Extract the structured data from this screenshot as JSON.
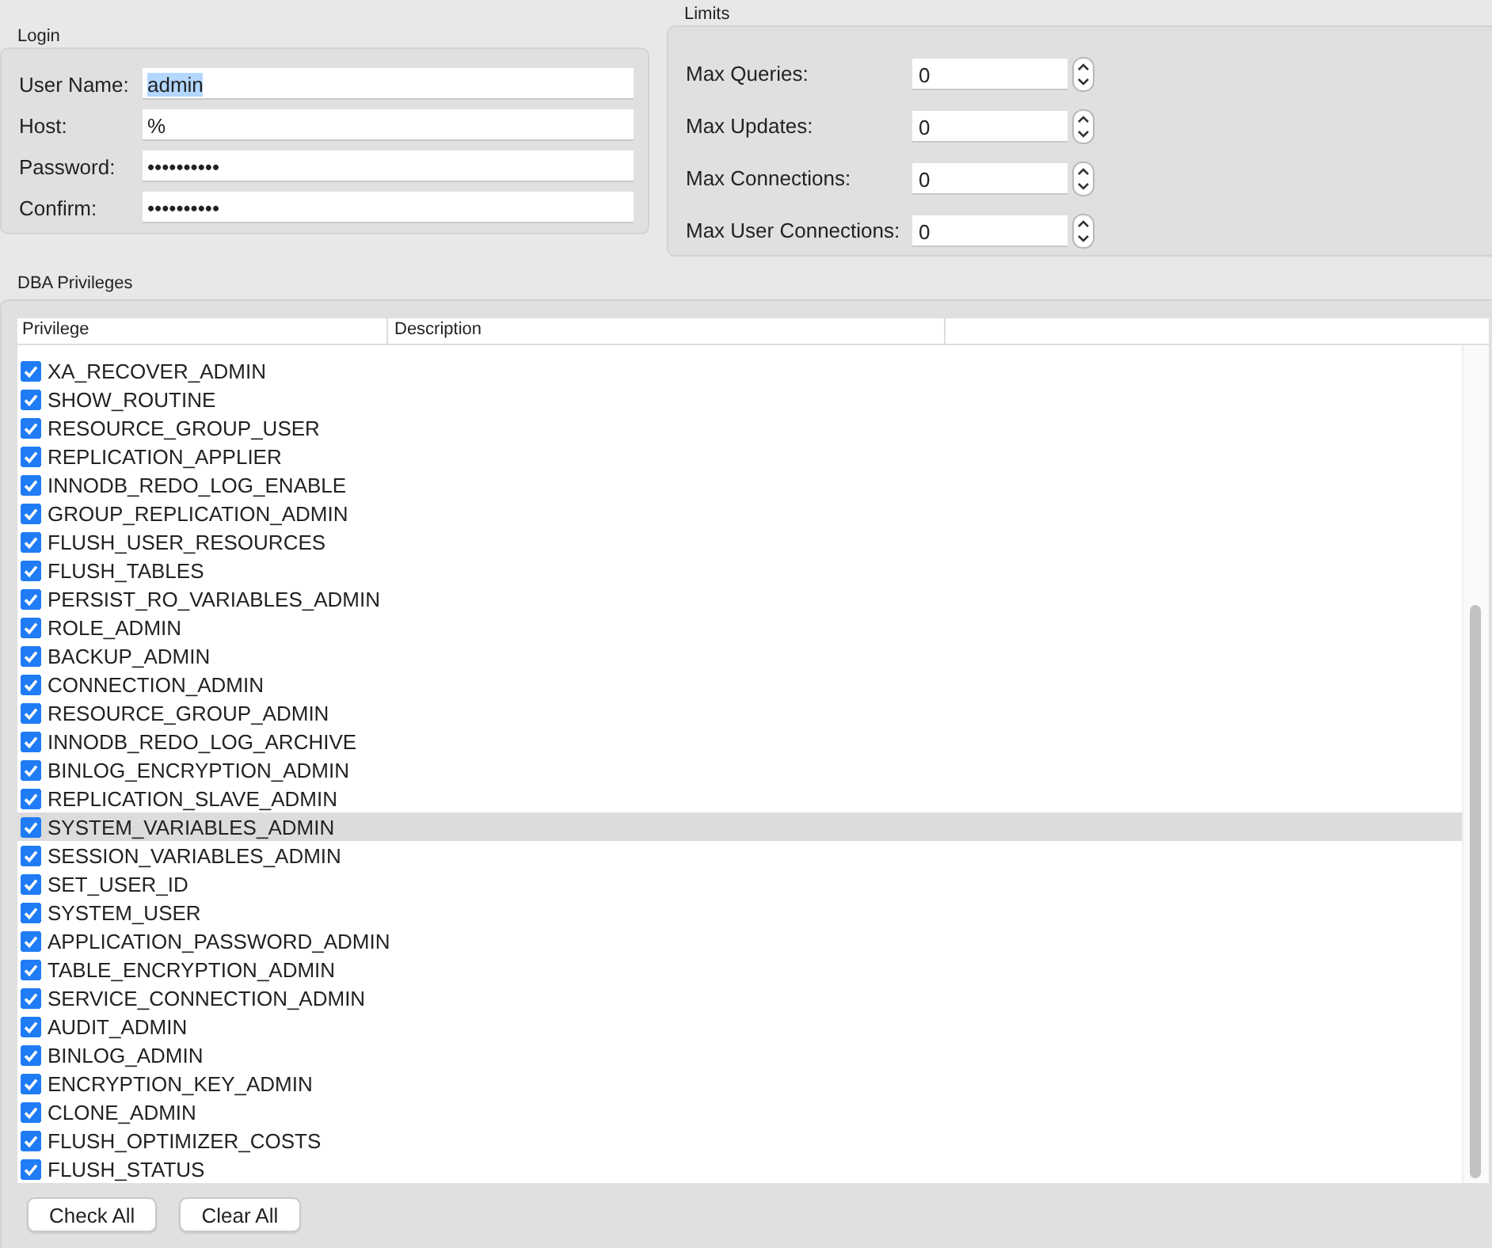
{
  "login": {
    "title": "Login",
    "fields": [
      {
        "label": "User Name:",
        "value": "admin",
        "text_selected": true
      },
      {
        "label": "Host:",
        "value": "%",
        "text_selected": false
      },
      {
        "label": "Password:",
        "value": "••••••••••",
        "text_selected": false
      },
      {
        "label": "Confirm:",
        "value": "••••••••••",
        "text_selected": false
      }
    ]
  },
  "limits": {
    "title": "Limits",
    "fields": [
      {
        "label": "Max Queries:",
        "value": "0"
      },
      {
        "label": "Max Updates:",
        "value": "0"
      },
      {
        "label": "Max Connections:",
        "value": "0"
      },
      {
        "label": "Max User Connections:",
        "value": "0"
      }
    ]
  },
  "privileges": {
    "title": "DBA Privileges",
    "columns": [
      "Privilege",
      "Description"
    ],
    "rows": [
      {
        "name": "XA_RECOVER_ADMIN",
        "checked": true,
        "selected": false
      },
      {
        "name": "SHOW_ROUTINE",
        "checked": true,
        "selected": false
      },
      {
        "name": "RESOURCE_GROUP_USER",
        "checked": true,
        "selected": false
      },
      {
        "name": "REPLICATION_APPLIER",
        "checked": true,
        "selected": false
      },
      {
        "name": "INNODB_REDO_LOG_ENABLE",
        "checked": true,
        "selected": false
      },
      {
        "name": "GROUP_REPLICATION_ADMIN",
        "checked": true,
        "selected": false
      },
      {
        "name": "FLUSH_USER_RESOURCES",
        "checked": true,
        "selected": false
      },
      {
        "name": "FLUSH_TABLES",
        "checked": true,
        "selected": false
      },
      {
        "name": "PERSIST_RO_VARIABLES_ADMIN",
        "checked": true,
        "selected": false
      },
      {
        "name": "ROLE_ADMIN",
        "checked": true,
        "selected": false
      },
      {
        "name": "BACKUP_ADMIN",
        "checked": true,
        "selected": false
      },
      {
        "name": "CONNECTION_ADMIN",
        "checked": true,
        "selected": false
      },
      {
        "name": "RESOURCE_GROUP_ADMIN",
        "checked": true,
        "selected": false
      },
      {
        "name": "INNODB_REDO_LOG_ARCHIVE",
        "checked": true,
        "selected": false
      },
      {
        "name": "BINLOG_ENCRYPTION_ADMIN",
        "checked": true,
        "selected": false
      },
      {
        "name": "REPLICATION_SLAVE_ADMIN",
        "checked": true,
        "selected": false
      },
      {
        "name": "SYSTEM_VARIABLES_ADMIN",
        "checked": true,
        "selected": true
      },
      {
        "name": "SESSION_VARIABLES_ADMIN",
        "checked": true,
        "selected": false
      },
      {
        "name": "SET_USER_ID",
        "checked": true,
        "selected": false
      },
      {
        "name": "SYSTEM_USER",
        "checked": true,
        "selected": false
      },
      {
        "name": "APPLICATION_PASSWORD_ADMIN",
        "checked": true,
        "selected": false
      },
      {
        "name": "TABLE_ENCRYPTION_ADMIN",
        "checked": true,
        "selected": false
      },
      {
        "name": "SERVICE_CONNECTION_ADMIN",
        "checked": true,
        "selected": false
      },
      {
        "name": "AUDIT_ADMIN",
        "checked": true,
        "selected": false
      },
      {
        "name": "BINLOG_ADMIN",
        "checked": true,
        "selected": false
      },
      {
        "name": "ENCRYPTION_KEY_ADMIN",
        "checked": true,
        "selected": false
      },
      {
        "name": "CLONE_ADMIN",
        "checked": true,
        "selected": false
      },
      {
        "name": "FLUSH_OPTIMIZER_COSTS",
        "checked": true,
        "selected": false
      },
      {
        "name": "FLUSH_STATUS",
        "checked": true,
        "selected": false
      }
    ]
  },
  "buttons": [
    "Check All",
    "Clear All"
  ]
}
